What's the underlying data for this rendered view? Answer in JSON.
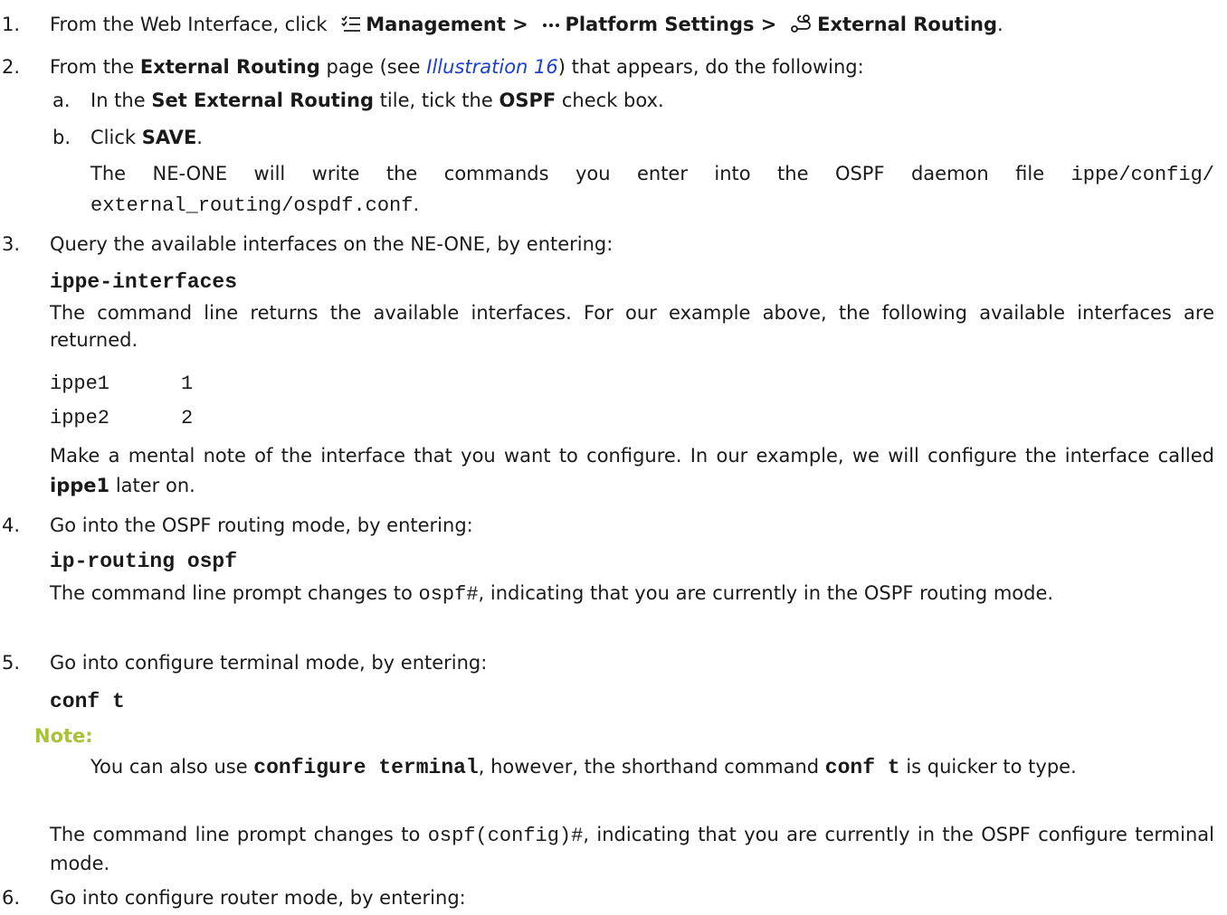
{
  "step1": {
    "num": "1.",
    "prefix": "From the Web Interface, click",
    "menu1": "Management >",
    "menu2": "Platform Settings >",
    "menu3": "External Routing",
    "suffix": "."
  },
  "step2": {
    "num": "2.",
    "t1": "From the",
    "bold1": "External Routing",
    "t2": "page (see",
    "link": "Illustration 16",
    "t3": ") that appears, do the following:",
    "a_num": "a.",
    "a_t1": "In the",
    "a_bold1": "Set External Routing",
    "a_t2": "tile, tick the",
    "a_bold2": "OSPF",
    "a_t3": "check box.",
    "b_num": "b.",
    "b_t1": "Click",
    "b_bold": "SAVE",
    "b_t2": ".",
    "b_para1": "The NE-ONE will write the commands you enter into the OSPF daemon file",
    "b_code1": "ippe/config/",
    "b_code2": "external_routing/ospdf.conf",
    "b_end": "."
  },
  "step3": {
    "num": "3.",
    "text": "Query the available interfaces on the NE-ONE, by entering:",
    "cmd": "ippe-interfaces",
    "para": "The command line returns the available interfaces. For our example above, the following available interfaces are returned.",
    "iface1_name": "ippe1",
    "iface1_id": "1",
    "iface2_name": "ippe2",
    "iface2_id": "2",
    "note_t1": "Make a mental note of the interface that you want to configure. In our example, we will configure the interface called",
    "note_bold": "ippe1",
    "note_t2": "later on."
  },
  "step4": {
    "num": "4.",
    "text": "Go into the OSPF routing mode, by entering:",
    "cmd": "ip-routing ospf",
    "p_t1": "The command line prompt changes to",
    "p_code": "ospf#",
    "p_t2": ", indicating that you are currently in the OSPF routing mode."
  },
  "step5": {
    "num": "5.",
    "text": "Go into configure terminal mode, by entering:",
    "cmd": "conf t",
    "note_label": "Note:",
    "note_t1": "You can also use",
    "note_cmd1": "configure terminal",
    "note_t2": ", however, the shorthand command",
    "note_cmd2": "conf t",
    "note_t3": "is quicker to type.",
    "p_t1": "The command line prompt changes to",
    "p_code": "ospf(config)#",
    "p_t2": ", indicating that you are currently in the OSPF configure terminal mode."
  },
  "step6": {
    "num": "6.",
    "text": "Go into configure router mode, by entering:"
  },
  "colors": {
    "link": "#1a3fd1",
    "note": "#a8c23a",
    "text": "#1a1a1a"
  },
  "icons": [
    "management-icon",
    "more-icon",
    "routing-icon"
  ]
}
